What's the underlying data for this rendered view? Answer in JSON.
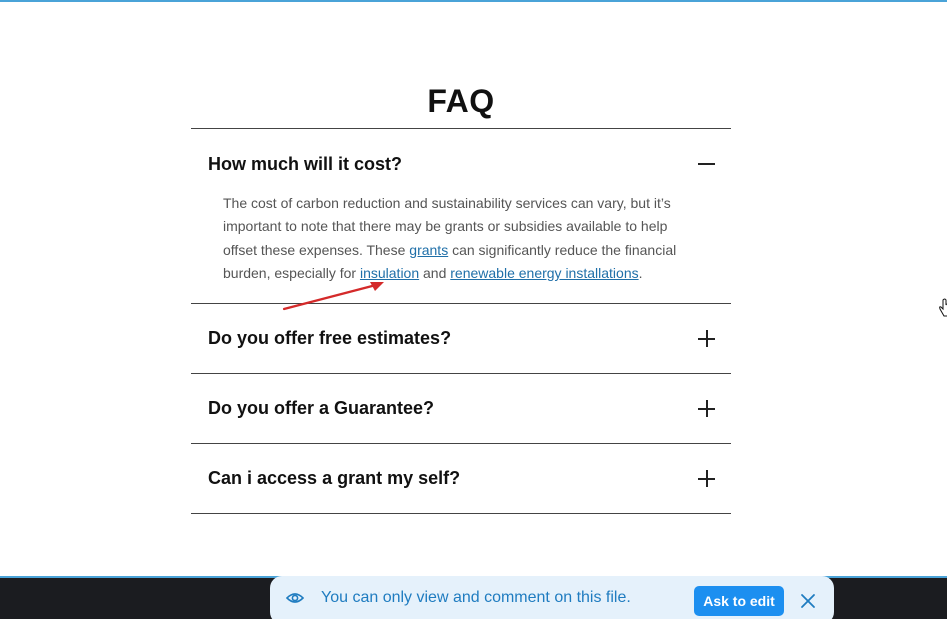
{
  "faq": {
    "title": "FAQ",
    "items": [
      {
        "question": "How much will it cost?",
        "state": "expanded",
        "toggle_icon": "minus-icon",
        "answer": {
          "part1": "The cost of carbon reduction and sustainability services can vary, but it’s important to note that there may be grants or subsidies available to help offset these expenses. These ",
          "link1": "grants",
          "part2": " can significantly reduce the financial burden, especially for ",
          "link2": "insulation",
          "part3": " and ",
          "link3": "renewable energy installations",
          "part4": "."
        }
      },
      {
        "question": "Do you offer free estimates?",
        "state": "collapsed",
        "toggle_icon": "plus-icon"
      },
      {
        "question": "Do you offer a Guarantee?",
        "state": "collapsed",
        "toggle_icon": "plus-icon"
      },
      {
        "question": "Can i access a grant my self?",
        "state": "collapsed",
        "toggle_icon": "plus-icon"
      }
    ]
  },
  "annotation": {
    "icon": "red-arrow-icon",
    "color": "#d42a2a"
  },
  "notice": {
    "icon": "eye-icon",
    "text": "You can only view and comment on this file.",
    "ask_button": "Ask to edit",
    "close_icon": "close-icon"
  },
  "colors": {
    "accent": "#1c8ff0",
    "link": "#1f6fa8",
    "notice_bg": "#e5f1fb",
    "footer_bg": "#1b1c20"
  }
}
